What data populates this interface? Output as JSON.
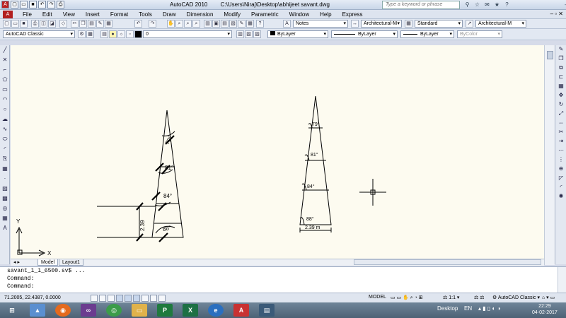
{
  "titlebar": {
    "app": "AutoCAD 2010",
    "file": "C:\\Users\\Niraj\\Desktop\\abhijeet savant.dwg",
    "search_placeholder": "Type a keyword or phrase"
  },
  "menu": [
    "File",
    "Edit",
    "View",
    "Insert",
    "Format",
    "Tools",
    "Draw",
    "Dimension",
    "Modify",
    "Parametric",
    "Window",
    "Help",
    "Express"
  ],
  "toolbars": {
    "text_style": "Notes",
    "dim_style": "Architectural-M",
    "table_style": "Standard",
    "mleader_style": "Architectural-M",
    "workspace": "AutoCAD Classic",
    "layer": "0",
    "color": "ByLayer",
    "linetype": "ByLayer",
    "lineweight": "ByLayer",
    "plotstyle": "ByColor"
  },
  "drawing": {
    "left_angles": [
      "79°",
      "81°",
      "84°",
      "88°"
    ],
    "left_dim": "2.39",
    "right_angles": [
      "79°",
      "81°",
      "84°",
      "88°"
    ],
    "right_dim": "2.39 m",
    "ucs_x": "X",
    "ucs_y": "Y"
  },
  "tabs": {
    "model": "Model",
    "layout1": "Layout1"
  },
  "command": {
    "line1": "savant_1_1_6500.sv$ ...",
    "line2": "Command:",
    "line3": "Command:"
  },
  "status": {
    "coords": "71.2005, 22.4387, 0.0000",
    "model": "MODEL",
    "scale": "1:1",
    "workspace": "AutoCAD Classic"
  },
  "taskbar": {
    "desktop": "Desktop",
    "lang": "EN",
    "time": "22:29",
    "date": "04-02-2017"
  }
}
